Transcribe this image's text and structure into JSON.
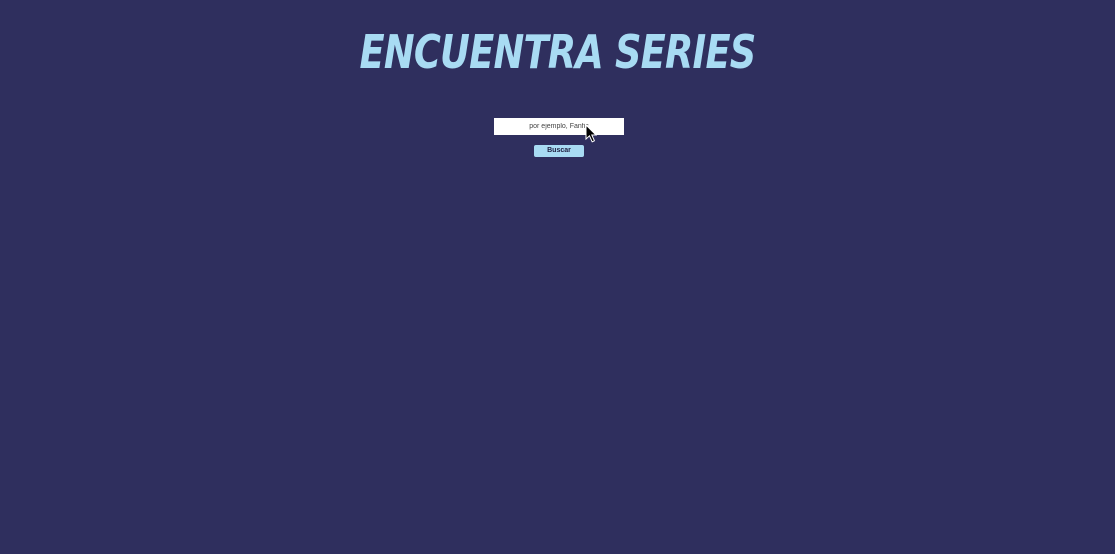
{
  "header": {
    "title": "Encuentra series"
  },
  "search": {
    "placeholder": "por ejemplo, Fanfic",
    "button_label": "Buscar"
  },
  "colors": {
    "background": "#2f2f5e",
    "accent": "#a8dbf3"
  },
  "icons": {
    "cursor": "mouse-pointer-icon"
  }
}
